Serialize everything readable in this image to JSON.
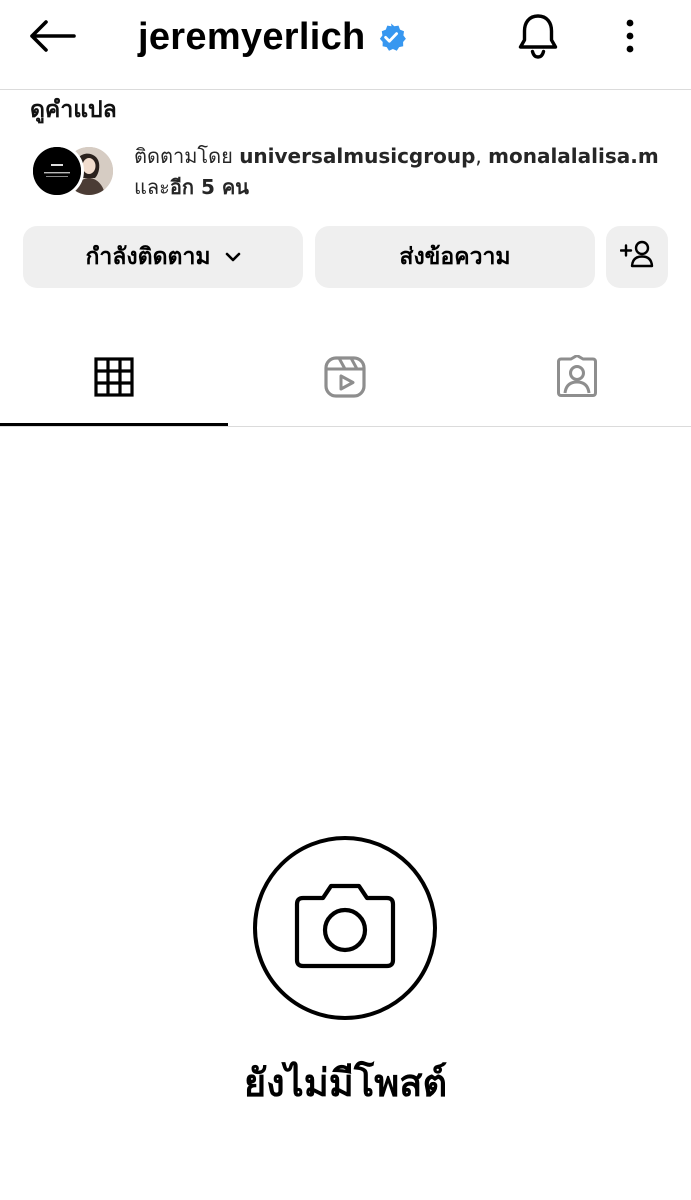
{
  "header": {
    "username": "jeremyerlich",
    "icons": [
      "back-arrow-icon",
      "verified-badge-icon",
      "bell-icon",
      "more-vertical-icon"
    ],
    "verified_color": "#3797f0"
  },
  "profile": {
    "translate_label": "ดูคำแปล",
    "followed_by": {
      "prefix": "ติดตามโดย",
      "user1": "universalmusicgroup",
      "separator": ",",
      "user2": "monalalalisa.m",
      "and_text": "และ",
      "others": "อีก 5 คน"
    }
  },
  "actions": {
    "following_label": "กำลังติดตาม",
    "message_label": "ส่งข้อความ"
  },
  "tabs": [
    {
      "name": "posts-grid",
      "icon": "grid-icon",
      "active": true
    },
    {
      "name": "reels",
      "icon": "reels-icon",
      "active": false
    },
    {
      "name": "tagged",
      "icon": "tagged-person-icon",
      "active": false
    }
  ],
  "empty_state": {
    "icon": "camera-icon",
    "text": "ยังไม่มีโพสต์"
  },
  "colors": {
    "button_bg": "#efefef",
    "divider": "#dbdbdb",
    "inactive_icon": "#8e8e8e"
  }
}
